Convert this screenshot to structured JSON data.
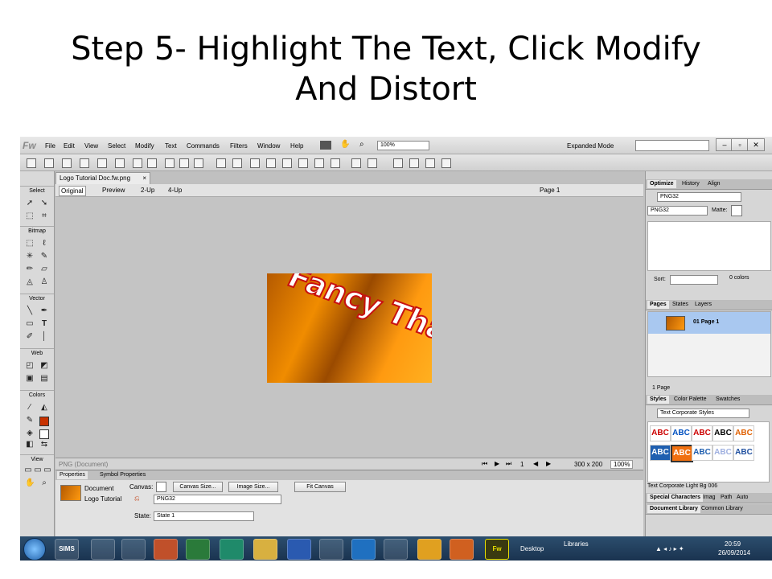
{
  "slide": {
    "title_line1": "Step 5- Highlight The Text, Click Modify",
    "title_line2": "And Distort"
  },
  "app": {
    "logo": "Fw",
    "menu": [
      "File",
      "Edit",
      "View",
      "Select",
      "Modify",
      "Text",
      "Commands",
      "Filters",
      "Window",
      "Help"
    ],
    "zoom_value": "100%",
    "mode": "Expanded Mode"
  },
  "tools": {
    "sections": [
      "Select",
      "Bitmap",
      "Vector",
      "Web",
      "Colors",
      "View"
    ]
  },
  "document": {
    "tab_title": "Logo Tutorial Doc.fw.png",
    "views": [
      "Original",
      "Preview",
      "2-Up",
      "4-Up"
    ],
    "page_selector": "Page 1",
    "artwork_text": "Fancy That",
    "status_left": "PNG (Document)",
    "page_count": "1",
    "dimensions": "300 x 200",
    "zoom": "100%"
  },
  "properties": {
    "tabs": [
      "Properties",
      "Symbol Properties"
    ],
    "doc_type": "Document",
    "doc_name": "Logo Tutorial",
    "canvas_label": "Canvas:",
    "canvas_size_btn": "Canvas Size...",
    "image_size_btn": "Image Size...",
    "fit_canvas_btn": "Fit Canvas",
    "format_value": "PNG32",
    "state_label": "State:",
    "state_value": "State 1"
  },
  "optimize": {
    "tabs": [
      "Optimize",
      "History",
      "Align"
    ],
    "preset": "PNG32",
    "format": "PNG32",
    "matte_label": "Matte:",
    "sort_label": "Sort:",
    "colors_count": "0 colors"
  },
  "pages": {
    "tabs": [
      "Pages",
      "States",
      "Layers"
    ],
    "page_item": "01  Page 1",
    "footer": "1 Page"
  },
  "styles": {
    "tabs": [
      "Styles",
      "Color Palette",
      "Swatches"
    ],
    "library": "Text Corporate Styles",
    "cell_text": "ABC",
    "selected_style": "Text Corporate Light Bg 006",
    "bottom_tabs_1": [
      "Special Characters",
      "Imag",
      "Path",
      "Auto"
    ],
    "bottom_tabs_2": [
      "Document Library",
      "Common Library"
    ]
  },
  "taskbar": {
    "apps": [
      "SIMS",
      "",
      "",
      "",
      "",
      "",
      "",
      "",
      "",
      "",
      "",
      "",
      "",
      "",
      "",
      "Fw"
    ],
    "desktop_label": "Desktop",
    "libraries_label": "Libraries",
    "time": "20:59",
    "date": "26/09/2014"
  },
  "colors": {
    "accent": "#a9c8f0",
    "artwork_orange": "#f08c00",
    "artwork_stroke": "#c81010"
  }
}
